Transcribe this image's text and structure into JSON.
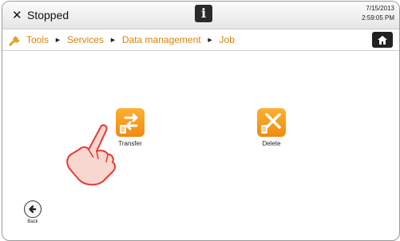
{
  "status": {
    "close_glyph": "✕",
    "state": "Stopped",
    "info_glyph": "i",
    "date": "7/15/2013",
    "time": "2:59:05 PM"
  },
  "breadcrumb": {
    "icon": "wrench-icon",
    "items": [
      "Tools",
      "Services",
      "Data management",
      "Job"
    ],
    "separator": "►"
  },
  "home": {
    "icon": "home-icon"
  },
  "tiles": [
    {
      "label": "Transfer",
      "icon": "transfer-icon"
    },
    {
      "label": "Delete",
      "icon": "delete-icon"
    }
  ],
  "back": {
    "label": "Back",
    "icon": "back-arrow-icon"
  },
  "colors": {
    "accent": "#ef8a10",
    "crumb": "#d9820f",
    "hand": "#e53935"
  }
}
